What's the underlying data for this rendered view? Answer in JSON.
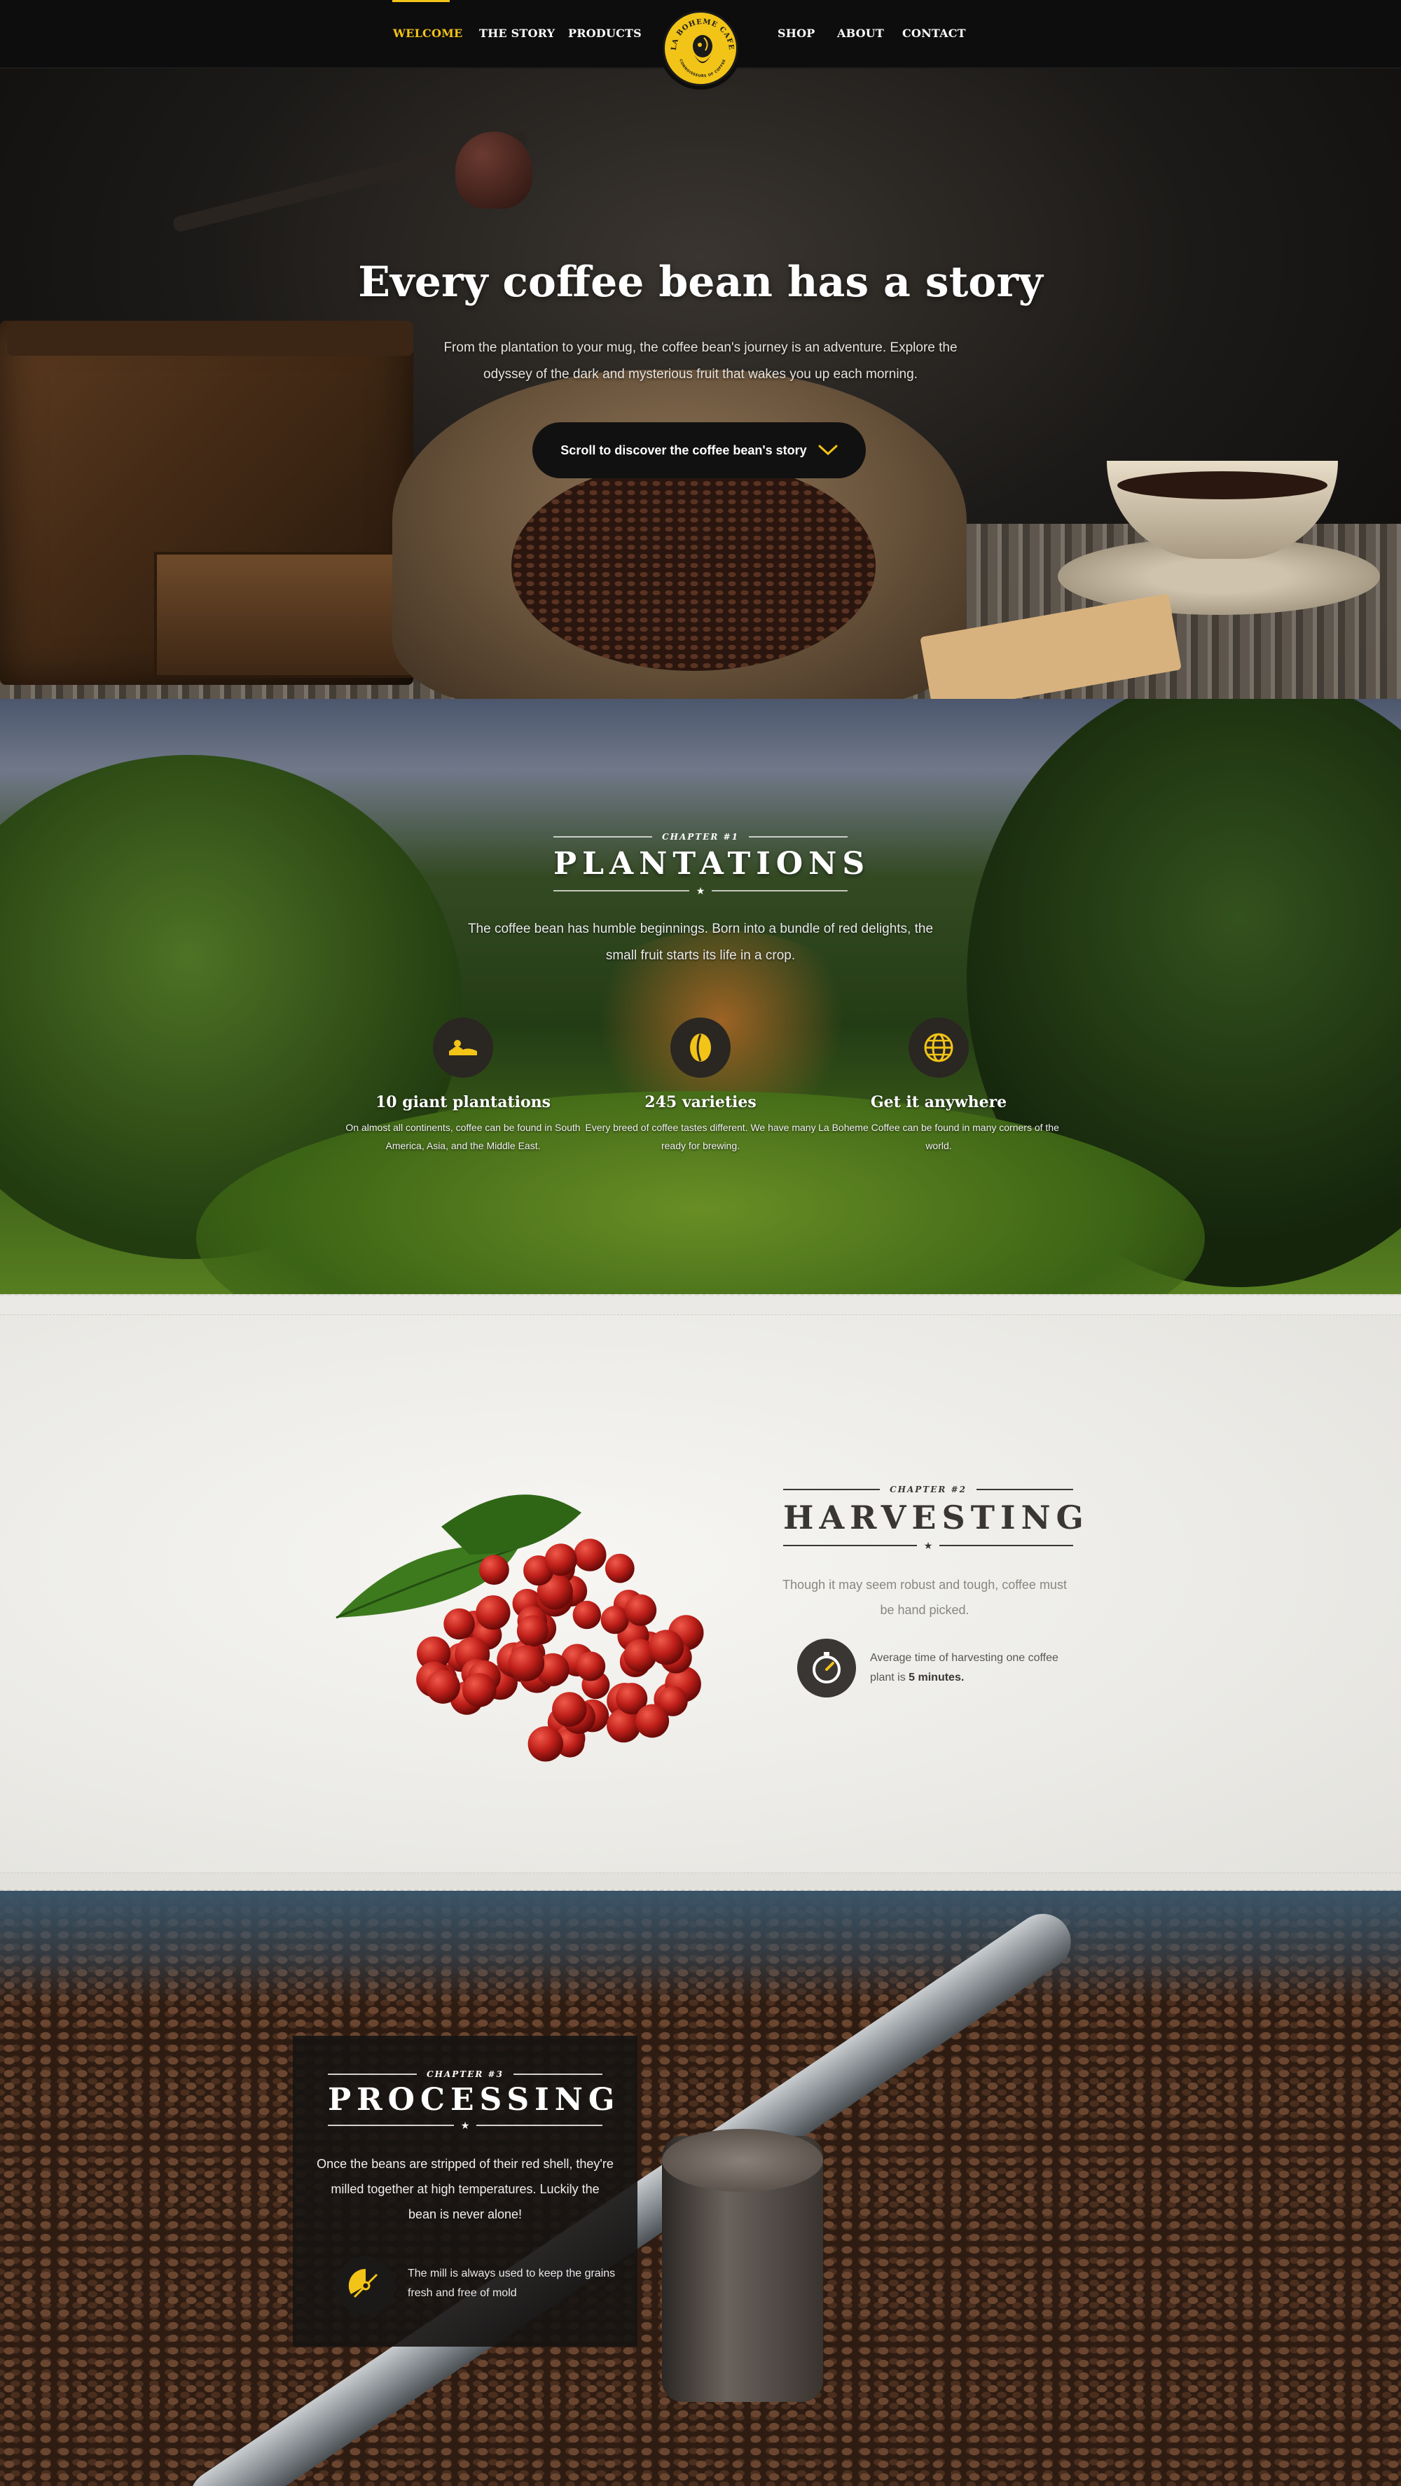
{
  "nav": {
    "left_items": [
      "WELCOME",
      "THE STORY",
      "PRODUCTS"
    ],
    "right_items": [
      "SHOP",
      "ABOUT",
      "CONTACT"
    ],
    "active": "WELCOME",
    "logo_text": "LA BOHEME CAFE",
    "logo_subtext": "CONNOISSEURS OF COFFEE"
  },
  "hero": {
    "title": "Every coffee bean has a story",
    "subtitle": "From the plantation to your mug, the coffee bean's journey is an adventure. Explore the odyssey of the dark and mysterious fruit that wakes you up each morning.",
    "button_label": "Scroll to discover the coffee bean's story"
  },
  "plantations": {
    "chapter": "CHAPTER #1",
    "title": "PLANTATIONS",
    "subtitle": "The coffee bean has humble beginnings. Born into a bundle of red delights, the small fruit starts its life in a crop.",
    "features": [
      {
        "icon": "plantation-icon",
        "title": "10 giant plantations",
        "text": "On almost all continents, coffee can be found in South America, Asia, and the Middle East."
      },
      {
        "icon": "coffee-bean-icon",
        "title": "245 varieties",
        "text": "Every breed of coffee tastes different. We have many ready for brewing."
      },
      {
        "icon": "globe-icon",
        "title": "Get it anywhere",
        "text": "La Boheme Coffee can be found in many corners of the world."
      }
    ]
  },
  "harvesting": {
    "chapter": "CHAPTER #2",
    "title": "HARVESTING",
    "subtitle": "Though it may seem robust and tough, coffee must be hand picked.",
    "stat_text": "Average time of harvesting one coffee plant is",
    "stat_value": "5 minutes."
  },
  "processing": {
    "chapter": "CHAPTER #3",
    "title": "PROCESSING",
    "text": "Once the beans are stripped of their red shell, they're milled together at high temperatures. Luckily the bean is never alone!",
    "mill_text": "The mill is always used to keep the grains fresh and free of mold"
  },
  "colors": {
    "accent": "#f2c418",
    "nav_bg": "#0d0d0d",
    "harvest_bg": "#ebeae6",
    "dark_text": "#3a3633"
  }
}
